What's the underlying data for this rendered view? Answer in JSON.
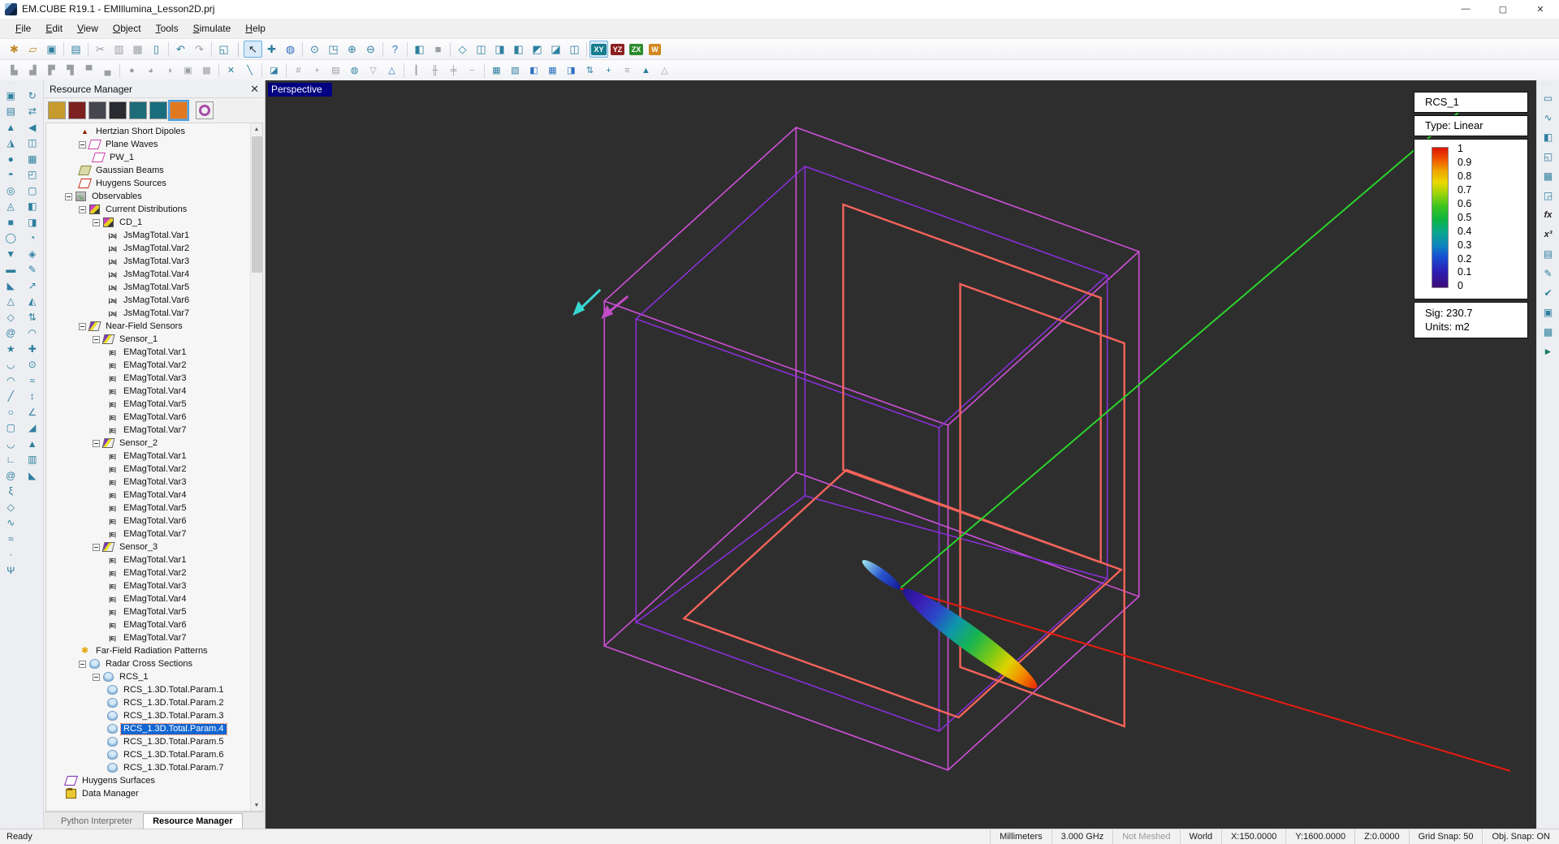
{
  "window": {
    "title": "EM.CUBE R19.1 - EMIllumina_Lesson2D.prj",
    "buttons": {
      "minimize": "—",
      "maximize": "▢",
      "close": "✕"
    }
  },
  "menu": [
    "File",
    "Edit",
    "View",
    "Object",
    "Tools",
    "Simulate",
    "Help"
  ],
  "toolbar_main": [
    {
      "g": "✱",
      "cls": "c-gold",
      "name": "new-project-button"
    },
    {
      "g": "▱",
      "cls": "c-gold",
      "name": "open-project-button"
    },
    {
      "g": "▣",
      "name": "save-button"
    },
    {
      "sep": 1
    },
    {
      "g": "▤",
      "name": "print-button"
    },
    {
      "sep": 1
    },
    {
      "g": "✂",
      "cls": "c-gray",
      "name": "cut-button"
    },
    {
      "g": "▥",
      "cls": "c-gray",
      "name": "copy-button"
    },
    {
      "g": "▦",
      "cls": "c-gray",
      "name": "paste-button"
    },
    {
      "g": "▯",
      "name": "delete-button"
    },
    {
      "sep": 1
    },
    {
      "g": "↶",
      "name": "undo-button"
    },
    {
      "g": "↷",
      "cls": "c-gray",
      "name": "redo-button"
    },
    {
      "sep": 1
    },
    {
      "g": "◱",
      "name": "project-window-button"
    },
    {
      "sep": 2
    },
    {
      "g": "↖",
      "cls": "c-dark",
      "active": true,
      "name": "select-tool-button"
    },
    {
      "g": "✚",
      "name": "pan-tool-button"
    },
    {
      "g": "◍",
      "cls": "c-blue",
      "name": "orbit-tool-button"
    },
    {
      "sep": 1
    },
    {
      "g": "⊙",
      "name": "zoom-extents-button"
    },
    {
      "g": "◳",
      "name": "zoom-window-button"
    },
    {
      "g": "⊕",
      "name": "zoom-in-button"
    },
    {
      "g": "⊖",
      "name": "zoom-out-button"
    },
    {
      "sep": 1
    },
    {
      "g": "?",
      "cls": "c-blue",
      "name": "context-help-button"
    },
    {
      "sep": 1
    },
    {
      "g": "◧",
      "name": "tile-views-button"
    },
    {
      "g": "■",
      "cls": "c-gray",
      "name": "blank-view-button"
    },
    {
      "sep": 1
    },
    {
      "g": "◇",
      "name": "axes-box-button"
    },
    {
      "g": "◫",
      "name": "view-iso-1-button"
    },
    {
      "g": "◨",
      "name": "view-iso-2-button"
    },
    {
      "g": "◧",
      "name": "view-iso-3-button"
    },
    {
      "g": "◩",
      "name": "view-iso-4-button"
    },
    {
      "g": "◪",
      "name": "view-iso-5-button"
    },
    {
      "g": "◫",
      "name": "view-iso-6-button"
    },
    {
      "sep": 1
    },
    {
      "txt": "XY",
      "cls": "bXY",
      "active": true,
      "name": "view-xy-button"
    },
    {
      "txt": "YZ",
      "cls": "bYZ",
      "name": "view-yz-button"
    },
    {
      "txt": "ZX",
      "cls": "bZX",
      "name": "view-zx-button"
    },
    {
      "txt": "W",
      "cls": "bW",
      "name": "view-w-button"
    }
  ],
  "toolbar_second": [
    {
      "g": "▙",
      "cls": "c-gray",
      "name": "step-tool-1"
    },
    {
      "g": "▟",
      "cls": "c-gray",
      "name": "step-tool-2"
    },
    {
      "g": "▛",
      "cls": "c-gray",
      "name": "step-tool-3"
    },
    {
      "g": "▜",
      "cls": "c-gray",
      "name": "step-tool-4"
    },
    {
      "g": "▀",
      "cls": "c-gray",
      "name": "line-tool-1"
    },
    {
      "g": "▄",
      "cls": "c-gray",
      "name": "line-tool-2"
    },
    {
      "sep": 1
    },
    {
      "g": "●",
      "cls": "c-gray",
      "name": "round-tool-1"
    },
    {
      "g": "◕",
      "cls": "c-gray",
      "name": "round-tool-2"
    },
    {
      "g": "◑",
      "cls": "c-gray",
      "name": "round-tool-3"
    },
    {
      "g": "▣",
      "cls": "c-gray",
      "name": "box-tool-1"
    },
    {
      "g": "▩",
      "cls": "c-gray",
      "name": "box-tool-2"
    },
    {
      "sep": 1
    },
    {
      "g": "✕",
      "name": "intersect-tool"
    },
    {
      "g": "╲",
      "name": "slant-tool"
    },
    {
      "sep": 1
    },
    {
      "g": "◪",
      "name": "surface-tool"
    },
    {
      "sep": 1
    },
    {
      "g": "#",
      "cls": "c-gray",
      "name": "grid-tool"
    },
    {
      "g": "+",
      "cls": "c-gray",
      "name": "snap-tool"
    },
    {
      "g": "▤",
      "cls": "c-gray",
      "name": "layers-tool"
    },
    {
      "g": "◍",
      "name": "material-tool"
    },
    {
      "g": "▽",
      "cls": "c-gray",
      "name": "mesh-down-tool"
    },
    {
      "g": "△",
      "cls": "c-blue",
      "name": "mesh-up-tool"
    },
    {
      "sep": 1
    },
    {
      "g": "┃",
      "cls": "c-gray",
      "name": "ruler-v-tool"
    },
    {
      "g": "╫",
      "cls": "c-gray",
      "name": "ruler-grid-tool"
    },
    {
      "g": "╪",
      "cls": "c-gray",
      "name": "ruler-grid-2-tool"
    },
    {
      "g": "−",
      "cls": "c-gray",
      "name": "minus-tool"
    },
    {
      "sep": 1
    },
    {
      "g": "▦",
      "name": "array-tool"
    },
    {
      "g": "▧",
      "name": "hatch-tool"
    },
    {
      "g": "◧",
      "cls": "c-blue",
      "name": "split-left-tool"
    },
    {
      "g": "▦",
      "cls": "c-blue",
      "name": "table-tool"
    },
    {
      "g": "◨",
      "cls": "c-blue",
      "name": "split-right-tool"
    },
    {
      "g": "⇅",
      "name": "swap-tool"
    },
    {
      "g": "+",
      "name": "add-tool"
    },
    {
      "g": "≡",
      "cls": "c-gray",
      "name": "list-tool"
    },
    {
      "g": "▲",
      "name": "align-up-tool"
    },
    {
      "g": "△",
      "cls": "c-gray",
      "name": "align-up-2-tool"
    }
  ],
  "left_rail": {
    "shapes": [
      {
        "g": "▣",
        "name": "box-shape-tool"
      },
      {
        "g": "▤",
        "name": "cylinder-shape-tool"
      },
      {
        "g": "▲",
        "name": "cone-shape-tool"
      },
      {
        "g": "◮",
        "name": "truncated-cone-tool"
      },
      {
        "g": "●",
        "name": "sphere-shape-tool"
      },
      {
        "g": "◓",
        "name": "hemisphere-tool"
      },
      {
        "g": "◎",
        "name": "torus-tool"
      },
      {
        "g": "◬",
        "name": "tetrahedron-tool"
      },
      {
        "g": "■",
        "name": "rect-strip-tool"
      },
      {
        "g": "◯",
        "name": "circle-strip-tool"
      },
      {
        "g": "▼",
        "name": "teardrop-tool"
      },
      {
        "g": "▬",
        "name": "ellipse-tool"
      },
      {
        "g": "◣",
        "name": "right-triangle-tool"
      },
      {
        "g": "△",
        "name": "triangle-tool"
      },
      {
        "g": "◇",
        "name": "hexagon-tool"
      },
      {
        "g": "@",
        "name": "spiral-tool"
      },
      {
        "g": "★",
        "name": "star-tool"
      },
      {
        "g": "◡",
        "name": "crescent-tool"
      },
      {
        "g": "◠",
        "name": "fan-tool"
      },
      {
        "g": "╱",
        "name": "line-tool"
      },
      {
        "g": "○",
        "name": "circle-curve-tool"
      },
      {
        "g": "▢",
        "name": "rounded-rect-tool"
      },
      {
        "g": "◡",
        "name": "arc-tool"
      },
      {
        "g": "∟",
        "name": "polyline-l-tool"
      },
      {
        "g": "@",
        "name": "flat-spiral-tool"
      },
      {
        "g": "ξ",
        "name": "helix-tool"
      },
      {
        "g": "◇",
        "name": "polygon-tool"
      },
      {
        "g": "∿",
        "name": "curve-tool"
      },
      {
        "g": "≈",
        "name": "nurbs-tool"
      },
      {
        "g": "·",
        "name": "point-tool"
      },
      {
        "g": "Ψ",
        "name": "antenna-tool"
      }
    ],
    "tools": [
      {
        "g": "↻",
        "name": "rotate-tool"
      },
      {
        "g": "⇄",
        "name": "translate-tool"
      },
      {
        "g": "◀",
        "name": "mirror-tool"
      },
      {
        "g": "◫",
        "name": "group-tool"
      },
      {
        "g": "▦",
        "name": "array-copy-tool"
      },
      {
        "g": "◰",
        "name": "align-tool"
      },
      {
        "g": "▢",
        "name": "subtract-tool"
      },
      {
        "g": "◧",
        "name": "union-tool"
      },
      {
        "g": "◨",
        "name": "intersect-bool-tool"
      },
      {
        "g": "◔",
        "name": "explode-tool"
      },
      {
        "g": "◈",
        "name": "boolean-tool"
      },
      {
        "g": "✎",
        "name": "edit-tool"
      },
      {
        "g": "↗",
        "name": "extrude-tool"
      },
      {
        "g": "◭",
        "name": "loft-tool"
      },
      {
        "g": "⇅",
        "name": "flip-tool"
      },
      {
        "g": "◠",
        "name": "bend-tool"
      },
      {
        "g": "✚",
        "name": "cross-section-tool"
      },
      {
        "g": "⊙",
        "name": "revolve-tool"
      },
      {
        "g": "≈",
        "name": "wave-surface-tool"
      },
      {
        "g": "↕",
        "name": "stretch-tool"
      },
      {
        "g": "∠",
        "name": "angle-measure-tool"
      },
      {
        "g": "◢",
        "name": "taper-tool"
      },
      {
        "g": "▲",
        "name": "facet-tool"
      },
      {
        "g": "▥",
        "name": "ruler-measure-tool"
      },
      {
        "g": "◣",
        "name": "chamfer-tool"
      }
    ]
  },
  "right_rail": [
    {
      "g": "▭",
      "name": "measure-tool-button"
    },
    {
      "g": "∿",
      "name": "waveform-button"
    },
    {
      "g": "◧",
      "name": "mesh-view-button"
    },
    {
      "g": "◱",
      "name": "domain-box-button"
    },
    {
      "g": "▦",
      "name": "grid-settings-button"
    },
    {
      "g": "◲",
      "name": "mesh-settings-button"
    },
    {
      "g": "fx",
      "cls": "c-fx",
      "name": "function-editor-button"
    },
    {
      "g": "x³",
      "cls": "c-fx",
      "name": "variables-button"
    },
    {
      "g": "▤",
      "name": "script-button"
    },
    {
      "g": "✎",
      "name": "edit-script-button"
    },
    {
      "g": "✔",
      "name": "validate-button"
    },
    {
      "g": "▣",
      "name": "results-viewer-button"
    },
    {
      "g": "▦",
      "name": "calculator-button"
    },
    {
      "g": "►",
      "cls": "c-play",
      "name": "run-simulation-button"
    }
  ],
  "resource_manager": {
    "title": "Resource Manager",
    "close_glyph": "✕",
    "modules": [
      {
        "color": "#c79b2d",
        "name": "module-cubecad"
      },
      {
        "color": "#7d2020",
        "name": "module-fdtd"
      },
      {
        "color": "#46464e",
        "name": "module-propagation"
      },
      {
        "color": "#2a2a31",
        "name": "module-physical-optics"
      },
      {
        "color": "#1e6b7a",
        "name": "module-planar"
      },
      {
        "color": "#196e7d",
        "name": "module-metal"
      },
      {
        "color": "#e0781f",
        "cls": "sel",
        "name": "module-illumina-selected"
      },
      {
        "color": "#f0f0f0",
        "cls": "ring",
        "name": "module-terrano"
      }
    ],
    "tree": [
      {
        "level": 2,
        "icon": "dipole",
        "label": "Hertzian Short Dipoles"
      },
      {
        "level": 2,
        "icon": "pw",
        "toggle": true,
        "label": "Plane Waves"
      },
      {
        "level": 3,
        "icon": "pw",
        "label": "PW_1"
      },
      {
        "level": 2,
        "icon": "gauss",
        "label": "Gaussian Beams"
      },
      {
        "level": 2,
        "icon": "huy",
        "label": "Huygens Sources"
      },
      {
        "level": 1,
        "icon": "obs",
        "toggle": true,
        "label": "Observables"
      },
      {
        "level": 2,
        "icon": "cd",
        "toggle": true,
        "label": "Current Distributions"
      },
      {
        "level": 3,
        "icon": "cd",
        "toggle": true,
        "label": "CD_1"
      },
      {
        "level": 4,
        "icon": "js",
        "label": "JsMagTotal.Var1"
      },
      {
        "level": 4,
        "icon": "js",
        "label": "JsMagTotal.Var2"
      },
      {
        "level": 4,
        "icon": "js",
        "label": "JsMagTotal.Var3"
      },
      {
        "level": 4,
        "icon": "js",
        "label": "JsMagTotal.Var4"
      },
      {
        "level": 4,
        "icon": "js",
        "label": "JsMagTotal.Var5"
      },
      {
        "level": 4,
        "icon": "js",
        "label": "JsMagTotal.Var6"
      },
      {
        "level": 4,
        "icon": "js",
        "label": "JsMagTotal.Var7"
      },
      {
        "level": 2,
        "icon": "nf",
        "toggle": true,
        "label": "Near-Field Sensors"
      },
      {
        "level": 3,
        "icon": "nf",
        "toggle": true,
        "label": "Sensor_1"
      },
      {
        "level": 4,
        "icon": "e",
        "label": "EMagTotal.Var1"
      },
      {
        "level": 4,
        "icon": "e",
        "label": "EMagTotal.Var2"
      },
      {
        "level": 4,
        "icon": "e",
        "label": "EMagTotal.Var3"
      },
      {
        "level": 4,
        "icon": "e",
        "label": "EMagTotal.Var4"
      },
      {
        "level": 4,
        "icon": "e",
        "label": "EMagTotal.Var5"
      },
      {
        "level": 4,
        "icon": "e",
        "label": "EMagTotal.Var6"
      },
      {
        "level": 4,
        "icon": "e",
        "label": "EMagTotal.Var7"
      },
      {
        "level": 3,
        "icon": "nf",
        "toggle": true,
        "label": "Sensor_2"
      },
      {
        "level": 4,
        "icon": "e",
        "label": "EMagTotal.Var1"
      },
      {
        "level": 4,
        "icon": "e",
        "label": "EMagTotal.Var2"
      },
      {
        "level": 4,
        "icon": "e",
        "label": "EMagTotal.Var3"
      },
      {
        "level": 4,
        "icon": "e",
        "label": "EMagTotal.Var4"
      },
      {
        "level": 4,
        "icon": "e",
        "label": "EMagTotal.Var5"
      },
      {
        "level": 4,
        "icon": "e",
        "label": "EMagTotal.Var6"
      },
      {
        "level": 4,
        "icon": "e",
        "label": "EMagTotal.Var7"
      },
      {
        "level": 3,
        "icon": "nf",
        "toggle": true,
        "label": "Sensor_3"
      },
      {
        "level": 4,
        "icon": "e",
        "label": "EMagTotal.Var1"
      },
      {
        "level": 4,
        "icon": "e",
        "label": "EMagTotal.Var2"
      },
      {
        "level": 4,
        "icon": "e",
        "label": "EMagTotal.Var3"
      },
      {
        "level": 4,
        "icon": "e",
        "label": "EMagTotal.Var4"
      },
      {
        "level": 4,
        "icon": "e",
        "label": "EMagTotal.Var5"
      },
      {
        "level": 4,
        "icon": "e",
        "label": "EMagTotal.Var6"
      },
      {
        "level": 4,
        "icon": "e",
        "label": "EMagTotal.Var7"
      },
      {
        "level": 2,
        "icon": "ff",
        "label": "Far-Field Radiation Patterns"
      },
      {
        "level": 2,
        "icon": "rcs",
        "toggle": true,
        "label": "Radar Cross Sections"
      },
      {
        "level": 3,
        "icon": "rcs",
        "toggle": true,
        "label": "RCS_1"
      },
      {
        "level": 4,
        "icon": "rcs",
        "label": "RCS_1.3D.Total.Param.1"
      },
      {
        "level": 4,
        "icon": "rcs",
        "label": "RCS_1.3D.Total.Param.2"
      },
      {
        "level": 4,
        "icon": "rcs",
        "label": "RCS_1.3D.Total.Param.3"
      },
      {
        "level": 4,
        "icon": "rcs",
        "label": "RCS_1.3D.Total.Param.4",
        "selected": true
      },
      {
        "level": 4,
        "icon": "rcs",
        "label": "RCS_1.3D.Total.Param.5"
      },
      {
        "level": 4,
        "icon": "rcs",
        "label": "RCS_1.3D.Total.Param.6"
      },
      {
        "level": 4,
        "icon": "rcs",
        "label": "RCS_1.3D.Total.Param.7"
      },
      {
        "level": 1,
        "icon": "huys",
        "label": "Huygens Surfaces"
      },
      {
        "level": 1,
        "icon": "dm",
        "label": "Data Manager"
      }
    ],
    "tabs": [
      {
        "label": "Python Interpreter"
      },
      {
        "label": "Resource Manager",
        "active": true
      }
    ]
  },
  "viewport": {
    "view_label": "Perspective",
    "legend": {
      "title": "RCS_1",
      "type": "Type: Linear",
      "ticks": [
        "1",
        "0.9",
        "0.8",
        "0.7",
        "0.6",
        "0.5",
        "0.4",
        "0.3",
        "0.2",
        "0.1",
        "0"
      ],
      "sig": "Sig: 230.7",
      "units": "Units: m2",
      "colormap": [
        "#dd1400 0%",
        "#f05a00 9%",
        "#f0a800 17%",
        "#ead800 25%",
        "#9cd40a 33%",
        "#3cc41e 42%",
        "#0cb446 52%",
        "#0aa88a 60%",
        "#0e86c0 70%",
        "#1650d2 78%",
        "#2a20b8 88%",
        "#400a78 100%"
      ]
    },
    "colors": {
      "vp_bg": "#2e2e2e",
      "box_outer": "#cf4fd8",
      "box_inner": "#8d2fe0",
      "plate": "#f4645a",
      "axis_green": "#2bd32b",
      "axis_red": "#e81b10",
      "arrow_cyan": "#38d8d2",
      "arrow_magenta": "#c24cc8"
    }
  },
  "status_bar": {
    "ready": "Ready",
    "items": [
      {
        "label": "Millimeters"
      },
      {
        "label": "3.000 GHz"
      },
      {
        "label": "Not Meshed",
        "cls": "dim"
      },
      {
        "label": "World"
      },
      {
        "label": "X:150.0000"
      },
      {
        "label": "Y:1600.0000"
      },
      {
        "label": "Z:0.0000"
      },
      {
        "label": "Grid Snap: 50"
      },
      {
        "label": "Obj. Snap: ON"
      }
    ]
  }
}
